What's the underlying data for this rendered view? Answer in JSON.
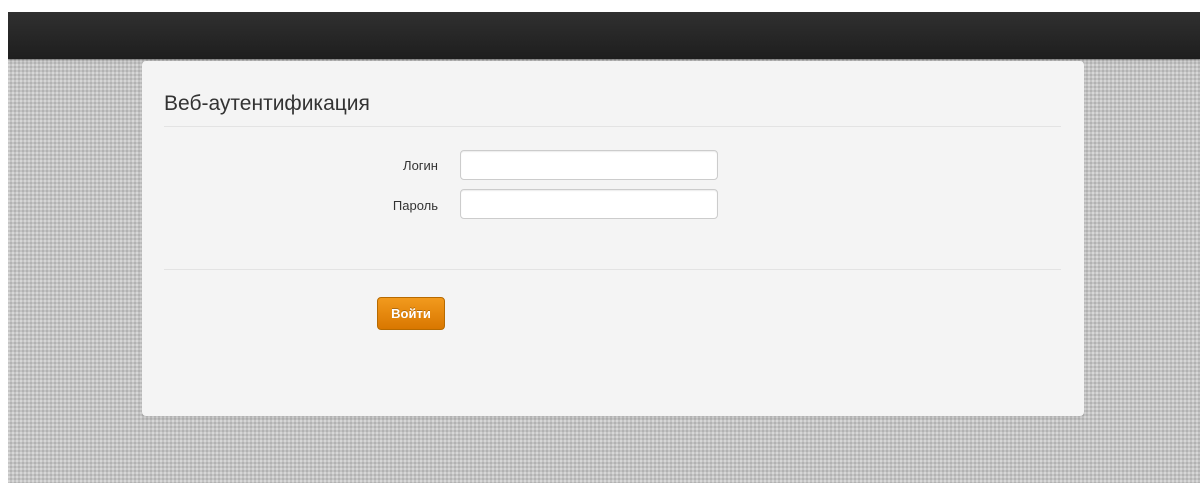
{
  "form": {
    "title": "Веб-аутентификация",
    "login_label": "Логин",
    "login_value": "",
    "password_label": "Пароль",
    "password_value": "",
    "submit_label": "Войти"
  },
  "colors": {
    "topbar": "#262626",
    "background": "#c4c4c4",
    "panel": "#f4f4f4",
    "submit_button": "#e6880c"
  }
}
